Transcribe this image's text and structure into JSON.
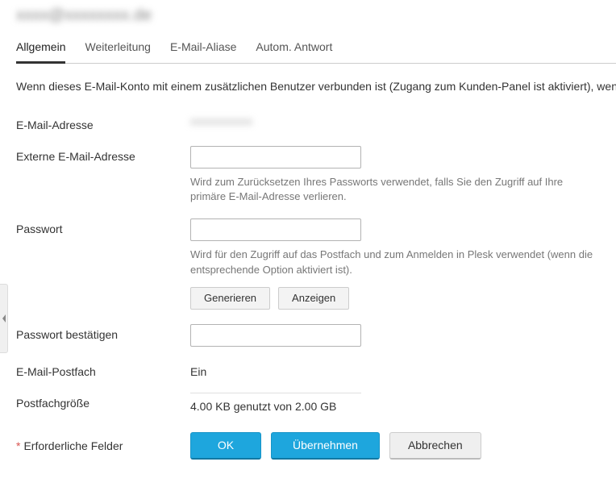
{
  "header": {
    "title_blurred": "xxxx@xxxxxxxx.de"
  },
  "tabs": [
    {
      "label": "Allgemein",
      "active": true
    },
    {
      "label": "Weiterleitung",
      "active": false
    },
    {
      "label": "E-Mail-Aliase",
      "active": false
    },
    {
      "label": "Autom. Antwort",
      "active": false
    }
  ],
  "description": "Wenn dieses E-Mail-Konto mit einem zusätzlichen Benutzer verbunden ist (Zugang zum Kunden-Panel ist aktiviert), wenn Sie die E-Mail-Adresse und das Passwort ändern, werden auch der Benutzername und das Passwort des zusä",
  "fields": {
    "email": {
      "label": "E-Mail-Adresse",
      "value_blurred": "xxxxxxxxxxx"
    },
    "external_email": {
      "label": "Externe E-Mail-Adresse",
      "value": "",
      "hint": "Wird zum Zurücksetzen Ihres Passworts verwendet, falls Sie den Zugriff auf Ihre primäre E-Mail-Adresse verlieren."
    },
    "password": {
      "label": "Passwort",
      "value": "",
      "hint": "Wird für den Zugriff auf das Postfach und zum Anmelden in Plesk verwendet (wenn die entsprechende Option aktiviert ist).",
      "generate_label": "Generieren",
      "show_label": "Anzeigen"
    },
    "password_confirm": {
      "label": "Passwort bestätigen",
      "value": ""
    },
    "mailbox": {
      "label": "E-Mail-Postfach",
      "value": "Ein"
    },
    "mailbox_size": {
      "label": "Postfachgröße",
      "usage": "4.00 KB genutzt von 2.00 GB"
    }
  },
  "footer": {
    "required_label": "Erforderliche Felder",
    "ok_label": "OK",
    "apply_label": "Übernehmen",
    "cancel_label": "Abbrechen"
  }
}
